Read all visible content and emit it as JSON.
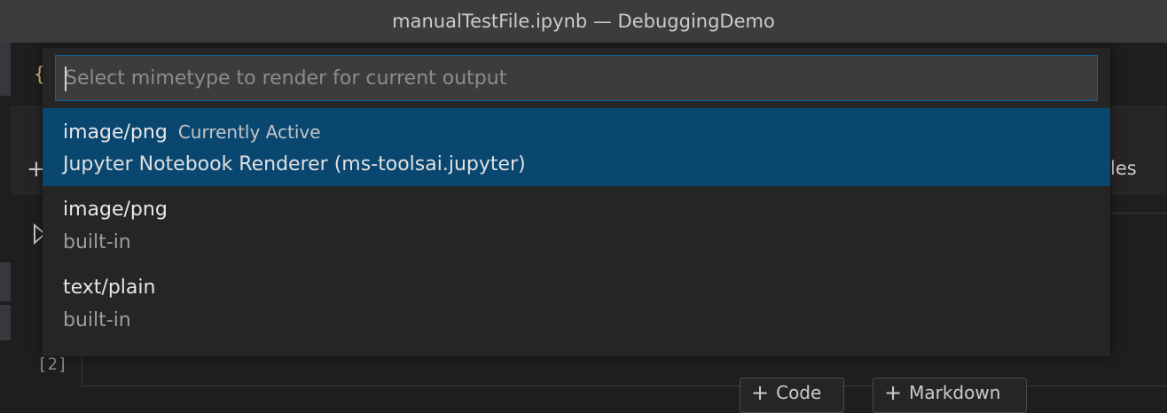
{
  "window": {
    "title": "manualTestFile.ipynb — DebuggingDemo"
  },
  "background": {
    "brace": "{",
    "toolbar_tail": "les",
    "execution_count": "[2]",
    "add_code_label": "Code",
    "add_markdown_label": "Markdown"
  },
  "quick_pick": {
    "placeholder": "Select mimetype to render for current output",
    "value": "",
    "items": [
      {
        "label": "image/png",
        "description": "Currently Active",
        "detail": "Jupyter Notebook Renderer (ms-toolsai.jupyter)",
        "active": true
      },
      {
        "label": "image/png",
        "description": "",
        "detail": "built-in",
        "active": false
      },
      {
        "label": "text/plain",
        "description": "",
        "detail": "built-in",
        "active": false
      }
    ]
  },
  "colors": {
    "selection": "#094771",
    "input_border": "#0e639c",
    "widget_bg": "#252526",
    "titlebar_bg": "#3c3c3c"
  },
  "icons": [
    "plus-icon",
    "run-cell-icon"
  ]
}
